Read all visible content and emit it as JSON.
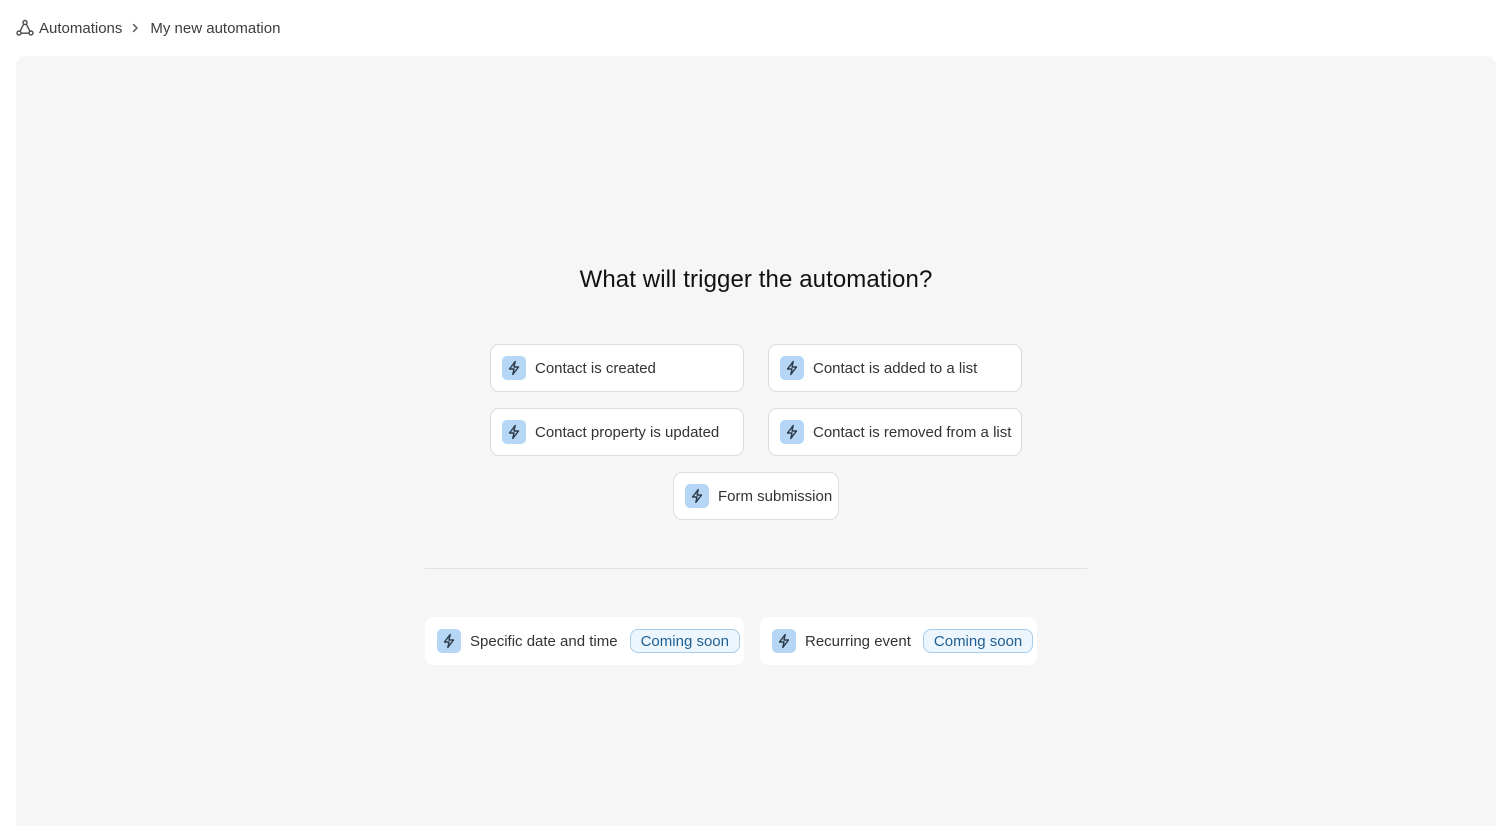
{
  "breadcrumb": {
    "icon": "automation-icon",
    "root": "Automations",
    "current": "My new automation"
  },
  "main": {
    "title": "What will trigger the automation?",
    "triggers": [
      {
        "label": "Contact is created",
        "icon": "lightning-icon"
      },
      {
        "label": "Contact is added to a list",
        "icon": "lightning-icon"
      },
      {
        "label": "Contact property is updated",
        "icon": "lightning-icon"
      },
      {
        "label": "Contact is removed from a list",
        "icon": "lightning-icon"
      },
      {
        "label": "Form submission",
        "icon": "lightning-icon"
      }
    ],
    "upcoming": [
      {
        "label": "Specific date and time",
        "badge": "Coming soon",
        "icon": "lightning-icon"
      },
      {
        "label": "Recurring event",
        "badge": "Coming soon",
        "icon": "lightning-icon"
      }
    ]
  },
  "colors": {
    "canvas": "#f6f6f6",
    "icon_bg": "#b5d6f5",
    "badge_text": "#1e5f93",
    "badge_border": "#a8cde9"
  }
}
